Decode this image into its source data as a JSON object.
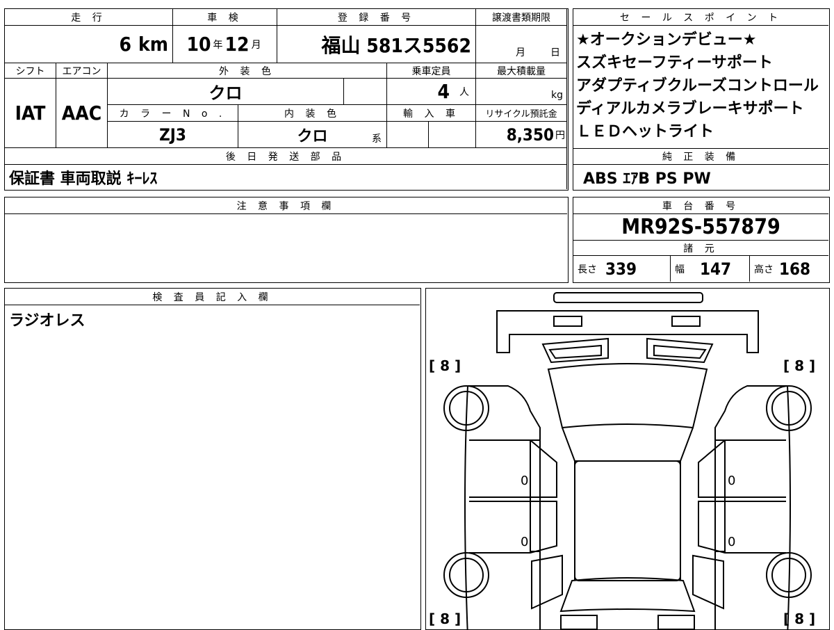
{
  "top": {
    "headers": {
      "mileage": "走 行",
      "inspection": "車 検",
      "registration": "登 録 番 号",
      "transfer_deadline": "譲渡書類期限",
      "sales_points": "セ ー ル ス ポ イ ン ト"
    },
    "mileage_value": "6",
    "mileage_unit": "km",
    "inspection_year": "10",
    "year_unit": "年",
    "inspection_month": "12",
    "month_unit": "月",
    "registration_value": "福山 581ス5562",
    "deadline_month_unit": "月",
    "deadline_day_unit": "日",
    "headers2": {
      "shift": "シフト",
      "aircon": "エアコン",
      "exterior_color": "外 装 色",
      "capacity": "乗車定員",
      "max_load": "最大積載量"
    },
    "shift_value": "IAT",
    "aircon_value": "AAC",
    "exterior_color_value": "クロ",
    "capacity_value": "4",
    "capacity_unit": "人",
    "max_load_unit": "kg",
    "headers3": {
      "color_no": "カ ラ ー N o .",
      "interior_color": "内 装 色",
      "import": "輸 入 車",
      "recycle": "リサイクル預託金"
    },
    "color_no_value": "ZJ3",
    "interior_color_value": "クロ",
    "interior_suffix": "系",
    "recycle_value": "8,350",
    "recycle_unit": "円",
    "later_parts_header": "後 日 発 送 部 品",
    "later_parts_value": "保証書 車両取説 ｷｰﾚｽ"
  },
  "sales_points": [
    "★オークションデビュー★",
    "スズキセーフティーサポート",
    "アダプティブクルーズコントロール",
    "ディアルカメラブレーキサポート",
    "ＬＥＤヘットライト"
  ],
  "genuine": {
    "header": "純 正 装 備",
    "value": "ABS ｴｱB PS PW"
  },
  "notes": {
    "header": "注 意 事 項 欄",
    "value": ""
  },
  "chassis": {
    "header": "車 台 番 号",
    "value": "MR92S-557879"
  },
  "specs": {
    "header": "諸 元",
    "length_label": "長さ",
    "length_value": "339",
    "width_label": "幅",
    "width_value": "147",
    "height_label": "高さ",
    "height_value": "168"
  },
  "inspector": {
    "header": "検 査 員 記 入 欄",
    "value": "ラジオレス"
  },
  "diagram": {
    "tire_fl": "[ 8 ]",
    "tire_fr": "[ 8 ]",
    "tire_rl": "[ 8 ]",
    "tire_rr": "[ 8 ]",
    "door_marks": [
      "0",
      "0",
      "0",
      "0"
    ]
  }
}
